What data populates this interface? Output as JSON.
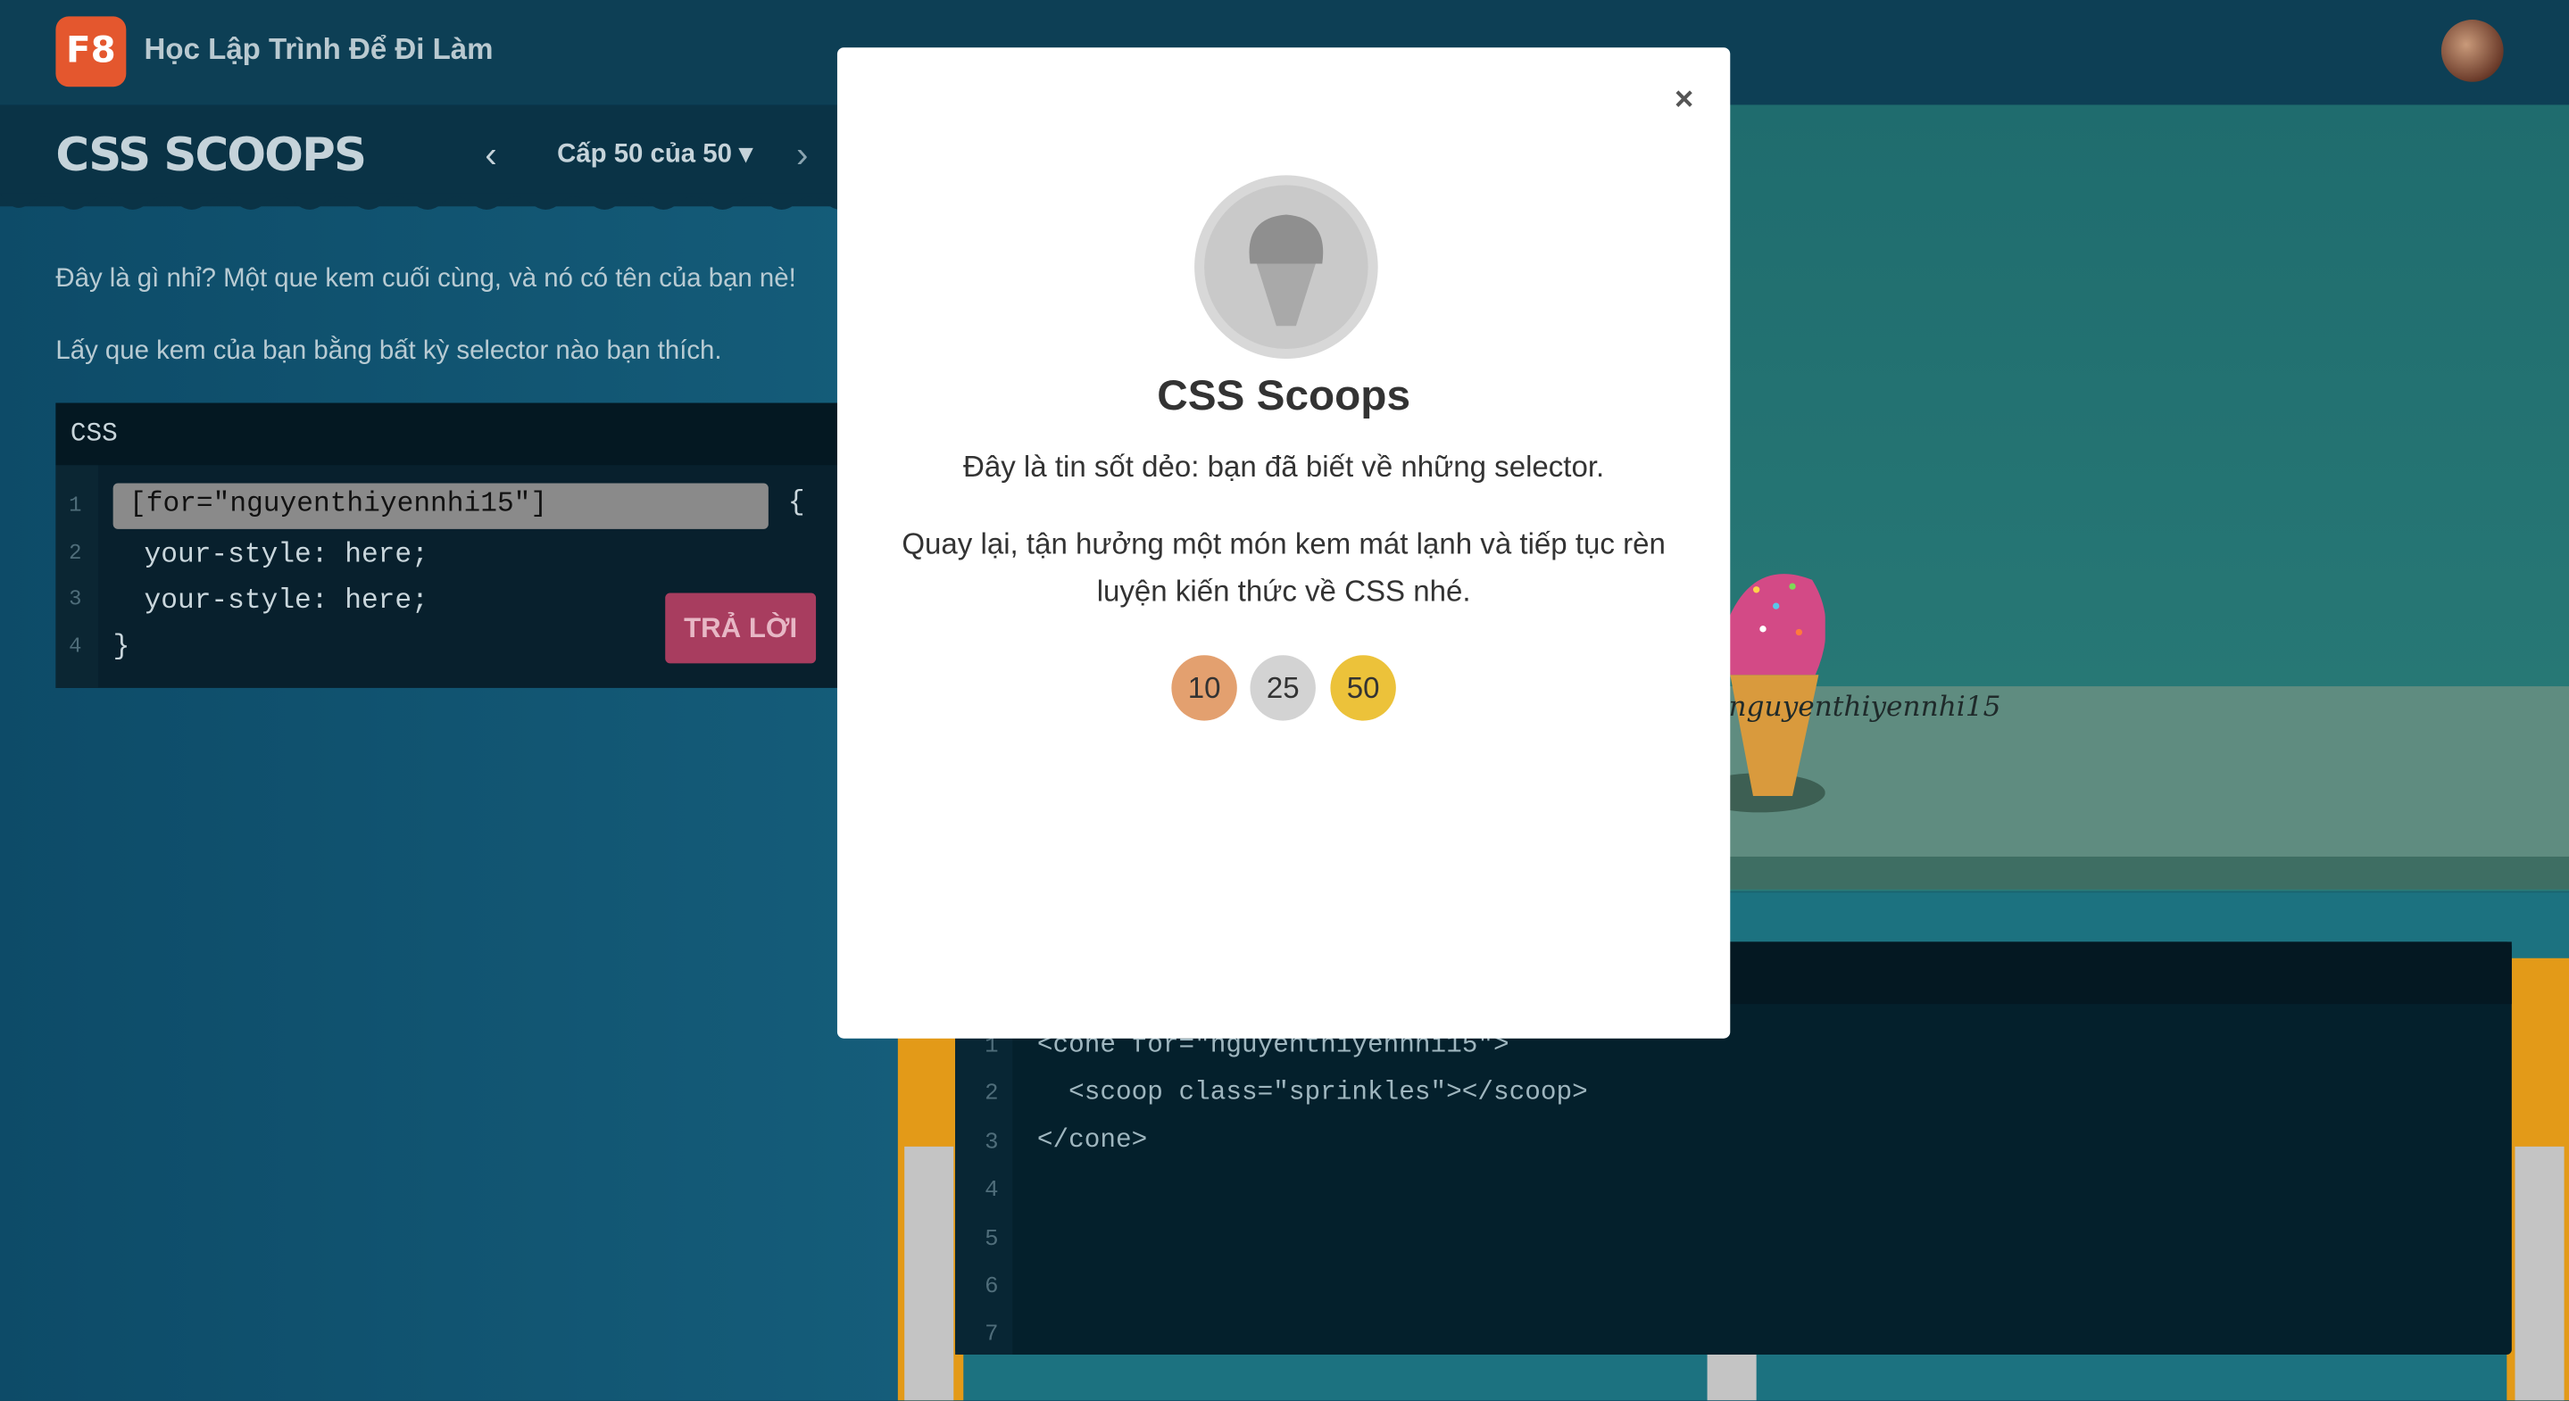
{
  "header": {
    "logo_text": "F8",
    "brand": "Học Lập Trình Để Đi Làm"
  },
  "game": {
    "title": "CSS SCOOPS",
    "level_select": "Cấp 50 của 50 ▾",
    "prev_icon": "‹",
    "next_icon": "›",
    "instructions": [
      "Đây là gì nhỉ? Một que kem cuối cùng, và nó có tên của bạn nè!",
      "Lấy que kem của bạn bằng bất kỳ selector nào bạn thích."
    ]
  },
  "css_editor": {
    "label": "CSS",
    "line_numbers": [
      "1",
      "2",
      "3",
      "4"
    ],
    "input_value": "[for=\"nguyenthiyennhi15\"]",
    "brace_open": "{",
    "line2": "your-style: here;",
    "line3": "your-style: here;",
    "brace_close": "}",
    "answer_button": "TRẢ LỜI"
  },
  "scene": {
    "cone_label": "nguyenthiyennhi15"
  },
  "html_editor": {
    "line_numbers": [
      "1",
      "2",
      "3",
      "4",
      "5",
      "6",
      "7"
    ],
    "lines": [
      "<cone for=\"nguyenthiyennhi15\">",
      "  <scoop class=\"sprinkles\"></scoop>",
      "</cone>"
    ]
  },
  "modal": {
    "close": "×",
    "title": "CSS Scoops",
    "text1": "Đây là tin sốt dẻo: bạn đã biết về những selector.",
    "text2": "Quay lại, tận hưởng một món kem mát lạnh và tiếp tục rèn luyện kiến thức về CSS nhé.",
    "levels": [
      {
        "label": "10",
        "color": "#e3a06f"
      },
      {
        "label": "25",
        "color": "#d3d3d3"
      },
      {
        "label": "50",
        "color": "#ecc23a"
      }
    ],
    "badge_icon": "ice-cream-cone-icon"
  }
}
